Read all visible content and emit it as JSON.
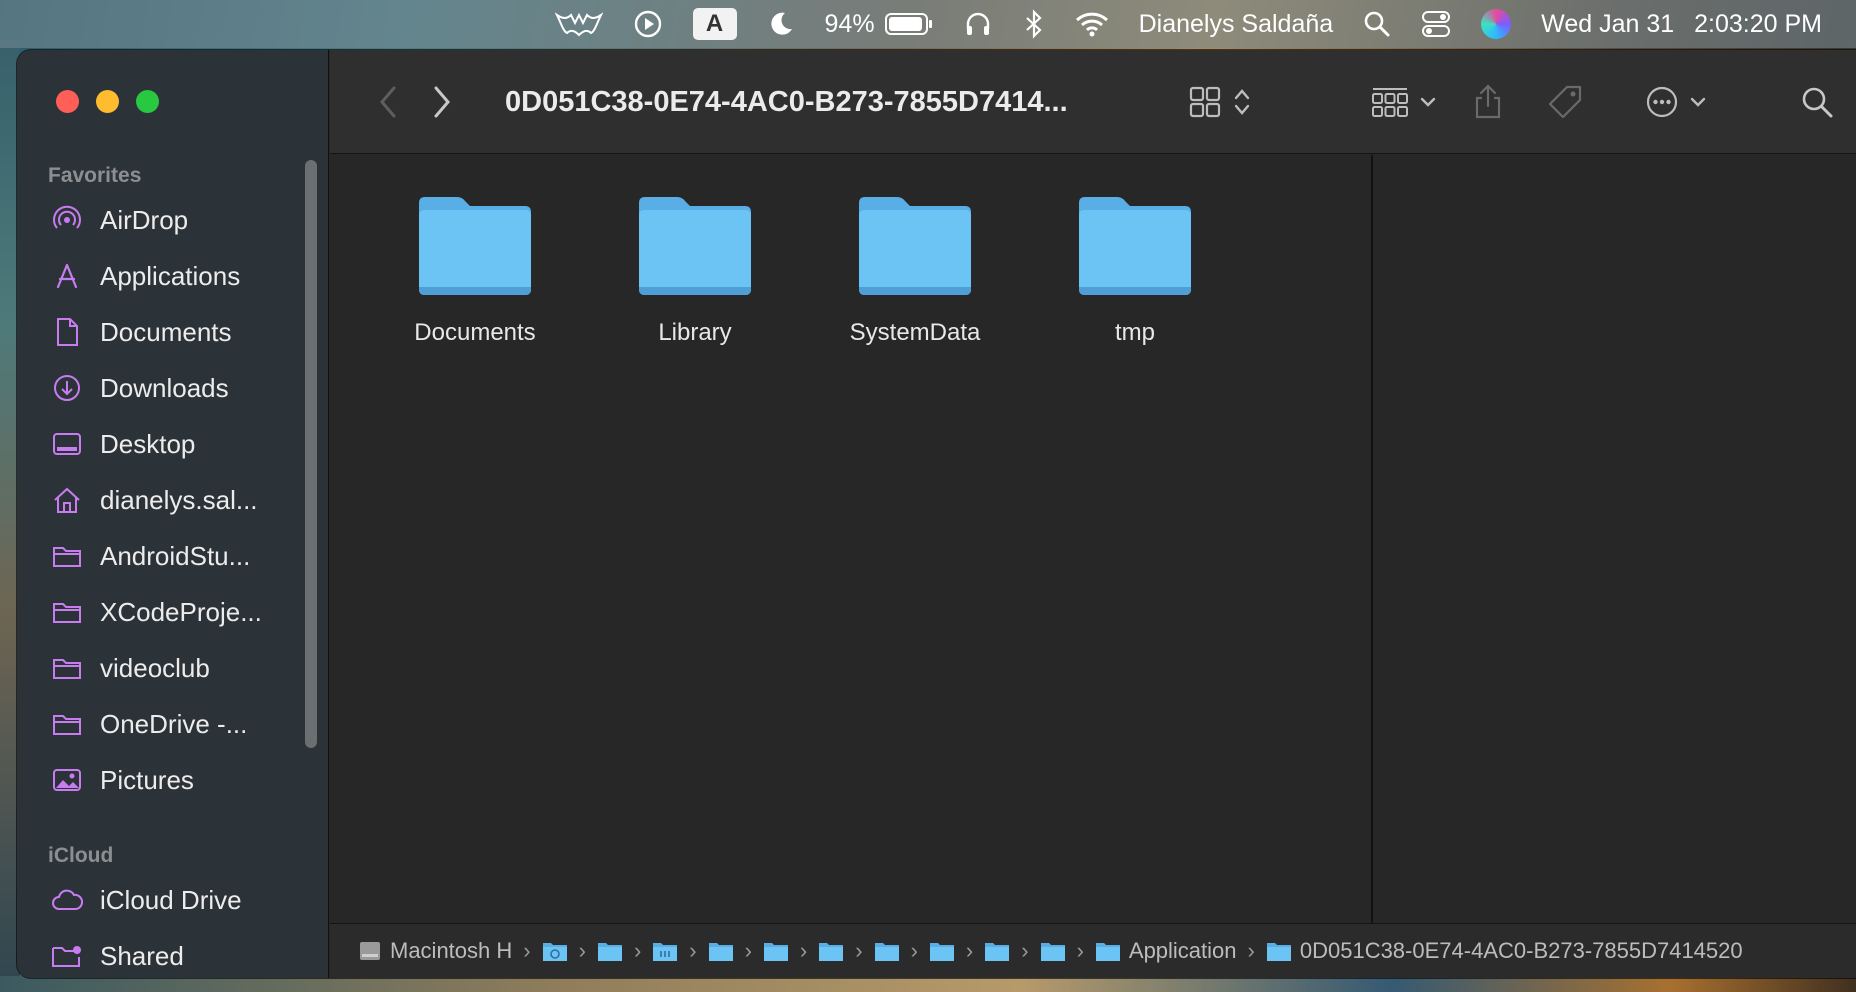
{
  "menubar": {
    "battery_percent": "94%",
    "user_name": "Dianelys Saldaña",
    "date": "Wed Jan 31",
    "time": "2:03:20 PM",
    "input_source": "A"
  },
  "sidebar": {
    "favorites_header": "Favorites",
    "favorites": [
      {
        "label": "AirDrop",
        "icon": "airdrop-icon"
      },
      {
        "label": "Applications",
        "icon": "applications-icon"
      },
      {
        "label": "Documents",
        "icon": "document-icon"
      },
      {
        "label": "Downloads",
        "icon": "download-icon"
      },
      {
        "label": "Desktop",
        "icon": "desktop-icon"
      },
      {
        "label": "dianelys.sal...",
        "icon": "home-icon"
      },
      {
        "label": "AndroidStu...",
        "icon": "folder-icon"
      },
      {
        "label": "XCodeProje...",
        "icon": "folder-icon"
      },
      {
        "label": "videoclub",
        "icon": "folder-icon"
      },
      {
        "label": "OneDrive -...",
        "icon": "folder-icon"
      },
      {
        "label": "Pictures",
        "icon": "pictures-icon"
      }
    ],
    "icloud_header": "iCloud",
    "icloud": [
      {
        "label": "iCloud Drive",
        "icon": "cloud-icon"
      },
      {
        "label": "Shared",
        "icon": "shared-folder-icon"
      }
    ]
  },
  "toolbar": {
    "title": "0D051C38-0E74-4AC0-B273-7855D7414..."
  },
  "content": {
    "folders": [
      {
        "name": "Documents"
      },
      {
        "name": "Library"
      },
      {
        "name": "SystemData"
      },
      {
        "name": "tmp"
      }
    ]
  },
  "pathbar": {
    "root_label": "Macintosh H",
    "app_label": "Application",
    "current_label": "0D051C38-0E74-4AC0-B273-7855D7414520",
    "separator": "›"
  },
  "colors": {
    "folder_blue": "#6cc4f5",
    "accent_purple": "#c77cf0",
    "close": "#ff5f57",
    "minimize": "#febc2e",
    "maximize": "#28c840"
  }
}
